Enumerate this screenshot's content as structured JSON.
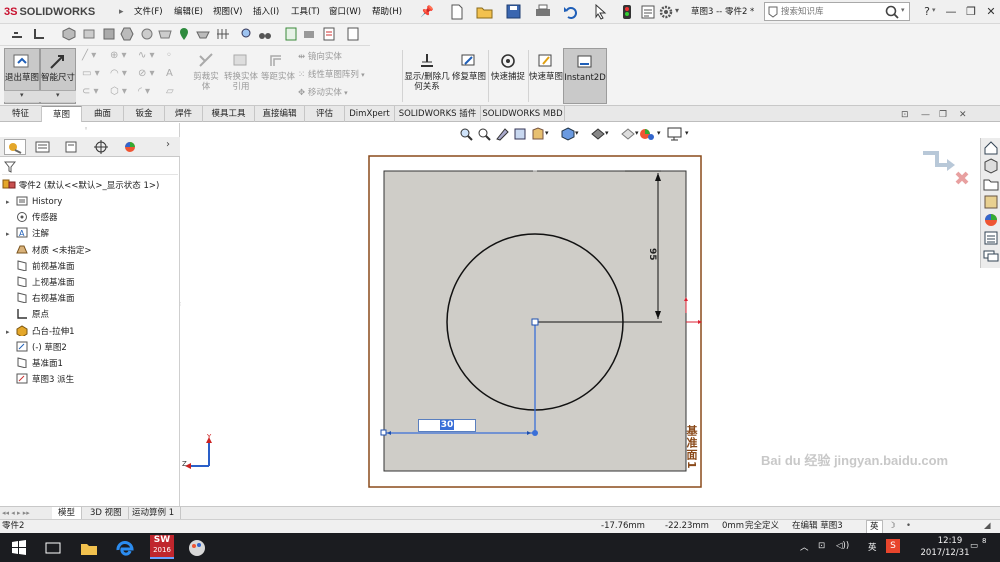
{
  "app": {
    "logo_ds": "3S",
    "logo_text": "SOLIDWORKS",
    "document_title": "草图3 -- 零件2 *",
    "search_placeholder": "搜索知识库"
  },
  "menu": [
    "文件(F)",
    "编辑(E)",
    "视图(V)",
    "插入(I)",
    "工具(T)",
    "窗口(W)",
    "帮助(H)"
  ],
  "window_controls": {
    "help": "?",
    "minimize": "—",
    "restore": "❐",
    "close": "✕"
  },
  "command_manager": {
    "exit_sketch": "退出草图",
    "smart_dimension": "智能尺寸",
    "trim": "剪裁实体",
    "convert": "转换实体引用",
    "offset": "等距实体",
    "mirror": "镜向实体",
    "linear_pattern": "线性草图阵列",
    "move": "移动实体",
    "show_relations": "显示/删除几何关系",
    "repair": "修复草图",
    "quick_snaps": "快速捕捉",
    "rapid_sketch": "快速草图",
    "instant2d": "Instant2D"
  },
  "tabs": [
    {
      "label": "特征",
      "active": false
    },
    {
      "label": "草图",
      "active": true
    },
    {
      "label": "曲面",
      "active": false
    },
    {
      "label": "钣金",
      "active": false
    },
    {
      "label": "焊件",
      "active": false
    },
    {
      "label": "模具工具",
      "active": false
    },
    {
      "label": "直接编辑",
      "active": false
    },
    {
      "label": "评估",
      "active": false
    },
    {
      "label": "DimXpert",
      "active": false
    },
    {
      "label": "SOLIDWORKS 插件",
      "active": false
    },
    {
      "label": "SOLIDWORKS MBD",
      "active": false
    }
  ],
  "tree": {
    "root": "零件2 (默认<<默认>_显示状态 1>)",
    "items": [
      {
        "label": "History",
        "icon": "history-icon",
        "expandable": true
      },
      {
        "label": "传感器",
        "icon": "sensor-icon",
        "expandable": false
      },
      {
        "label": "注解",
        "icon": "annotation-icon",
        "expandable": true
      },
      {
        "label": "材质 <未指定>",
        "icon": "material-icon",
        "expandable": false
      },
      {
        "label": "前视基准面",
        "icon": "plane-icon",
        "expandable": false
      },
      {
        "label": "上视基准面",
        "icon": "plane-icon",
        "expandable": false
      },
      {
        "label": "右视基准面",
        "icon": "plane-icon",
        "expandable": false
      },
      {
        "label": "原点",
        "icon": "origin-icon",
        "expandable": false
      },
      {
        "label": "凸台-拉伸1",
        "icon": "boss-extrude-icon",
        "expandable": true
      },
      {
        "label": "(-) 草图2",
        "icon": "sketch-icon",
        "expandable": false
      },
      {
        "label": "基准面1",
        "icon": "plane-icon",
        "expandable": false
      },
      {
        "label": "草图3 派生",
        "icon": "sketch-derived-icon",
        "expandable": false
      }
    ]
  },
  "viewport": {
    "plane_label": "基准面1",
    "dimension_input": "30",
    "vertical_dimension": "95",
    "triad_z": "Z",
    "triad_y": "Y"
  },
  "bottom_tabs": [
    {
      "label": "模型",
      "active": true
    },
    {
      "label": "3D 视图",
      "active": false
    },
    {
      "label": "运动算例 1",
      "active": false
    }
  ],
  "status": {
    "doc": "零件2",
    "x": "-17.76mm",
    "y": "-22.23mm",
    "z": "0mm",
    "state": "完全定义",
    "editing": "在编辑 草图3",
    "ime": "英"
  },
  "taskbar": {
    "sw_badge": "2016",
    "ime": "英",
    "time": "12:19",
    "date": "2017/12/31",
    "notifications": "8"
  },
  "watermark": "Bai du 经验 jingyan.baidu.com",
  "colors": {
    "sketch_blue": "#3a6fd8",
    "plane_brown": "#8a4a1a",
    "face_gray": "#cfcdc8",
    "taskbar": "#1b1c20"
  }
}
